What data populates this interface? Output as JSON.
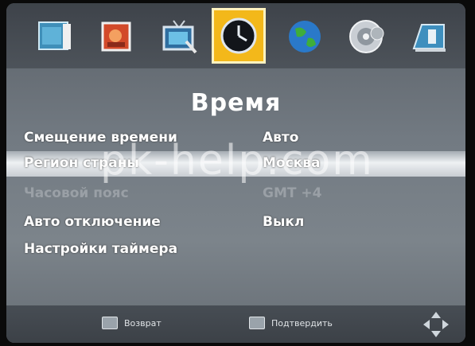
{
  "screen": {
    "title": "Время",
    "watermark": "pk-help.com"
  },
  "tabs": [
    {
      "icon": "picture-icon",
      "active": false
    },
    {
      "icon": "photo-icon",
      "active": false
    },
    {
      "icon": "tv-icon",
      "active": false
    },
    {
      "icon": "clock-icon",
      "active": true
    },
    {
      "icon": "globe-icon",
      "active": false
    },
    {
      "icon": "disc-icon",
      "active": false
    },
    {
      "icon": "usb-icon",
      "active": false
    }
  ],
  "settings": [
    {
      "label": "Смещение времени",
      "value": "Авто"
    },
    {
      "label": "Регион страны",
      "value": "Москва"
    },
    {
      "label": "Часовой пояс",
      "value": "GMT +4"
    },
    {
      "label": "Авто отключение",
      "value": "Выкл"
    },
    {
      "label": "Настройки таймера",
      "value": ""
    }
  ],
  "footer": {
    "back_label": "Возврат",
    "confirm_label": "Подтвердить"
  },
  "colors": {
    "accent": "#f3b81a",
    "text": "#ffffff",
    "disabled_text": "#9aa0a6"
  }
}
